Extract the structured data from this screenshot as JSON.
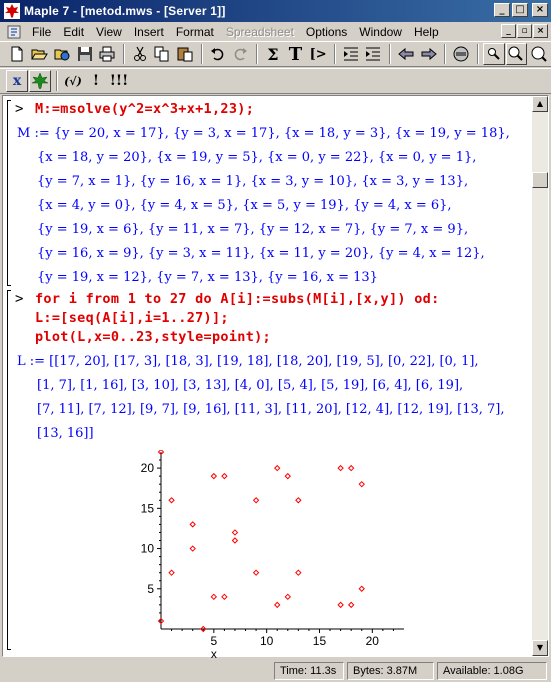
{
  "window": {
    "title": "Maple 7 - [metod.mws - [Server 1]]",
    "controls": [
      "_",
      "□",
      "×"
    ],
    "mdi_controls": [
      "_",
      "▫",
      "×"
    ]
  },
  "menu": {
    "items": [
      "File",
      "Edit",
      "View",
      "Insert",
      "Format",
      "Spreadsheet",
      "Options",
      "Window",
      "Help"
    ],
    "disabled": [
      "Spreadsheet"
    ]
  },
  "toolbar2": {
    "x_label": "x",
    "func_label": "(√)",
    "excl_label": "!",
    "excl3_label": "!!!"
  },
  "toolbar1": {
    "sigma_label": "Σ",
    "T_label": "T",
    "prompt_label": "[>"
  },
  "worksheet": {
    "prompt_symbol": ">",
    "group1": {
      "input": "M:=msolve(y^2=x^3+x+1,23);",
      "output_lines": [
        "M := {y = 20, x = 17}, {y = 3, x = 17}, {x = 18, y = 3}, {x = 19, y = 18},",
        "{x = 18, y = 20}, {x = 19, y = 5}, {x = 0, y = 22}, {x = 0, y = 1},",
        "{y = 7, x = 1}, {y = 16, x = 1}, {x = 3, y = 10}, {x = 3, y = 13},",
        "{x = 4, y = 0}, {y = 4, x = 5}, {x = 5, y = 19}, {y = 4, x = 6},",
        "{y = 19, x = 6}, {y = 11, x = 7}, {y = 12, x = 7}, {y = 7, x = 9},",
        "{y = 16, x = 9}, {y = 3, x = 11}, {x = 11, y = 20}, {y = 4, x = 12},",
        "{y = 19, x = 12}, {y = 7, x = 13}, {y = 16, x = 13}"
      ]
    },
    "group2": {
      "inputs": [
        "for i from 1 to 27 do A[i]:=subs(M[i],[x,y]) od:",
        "L:=[seq(A[i],i=1..27)];",
        "plot(L,x=0..23,style=point);"
      ],
      "output_lines": [
        "L := [[17, 20], [17, 3], [18, 3], [19, 18], [18, 20], [19, 5], [0, 22], [0, 1],",
        "[1, 7], [1, 16], [3, 10], [3, 13], [4, 0], [5, 4], [5, 19], [6, 4], [6, 19],",
        "[7, 11], [7, 12], [9, 7], [9, 16], [11, 3], [11, 20], [12, 4], [12, 19], [13, 7],",
        "[13, 16]]"
      ]
    }
  },
  "chart_data": {
    "type": "scatter",
    "title": "",
    "xlabel": "x",
    "ylabel": "",
    "xlim": [
      0,
      23
    ],
    "ylim": [
      0,
      22
    ],
    "xticks": [
      "5",
      "10",
      "15",
      "20"
    ],
    "yticks": [
      "5",
      "10",
      "15",
      "20"
    ],
    "grid": false,
    "point_color": "#ff0000",
    "points": [
      [
        17,
        20
      ],
      [
        17,
        3
      ],
      [
        18,
        3
      ],
      [
        19,
        18
      ],
      [
        18,
        20
      ],
      [
        19,
        5
      ],
      [
        0,
        22
      ],
      [
        0,
        1
      ],
      [
        1,
        7
      ],
      [
        1,
        16
      ],
      [
        3,
        10
      ],
      [
        3,
        13
      ],
      [
        4,
        0
      ],
      [
        5,
        4
      ],
      [
        5,
        19
      ],
      [
        6,
        4
      ],
      [
        6,
        19
      ],
      [
        7,
        11
      ],
      [
        7,
        12
      ],
      [
        9,
        7
      ],
      [
        9,
        16
      ],
      [
        11,
        3
      ],
      [
        11,
        20
      ],
      [
        12,
        4
      ],
      [
        12,
        19
      ],
      [
        13,
        7
      ],
      [
        13,
        16
      ]
    ]
  },
  "status": {
    "time": "Time: 11.3s",
    "bytes": "Bytes: 3.87M",
    "available": "Available: 1.08G"
  }
}
